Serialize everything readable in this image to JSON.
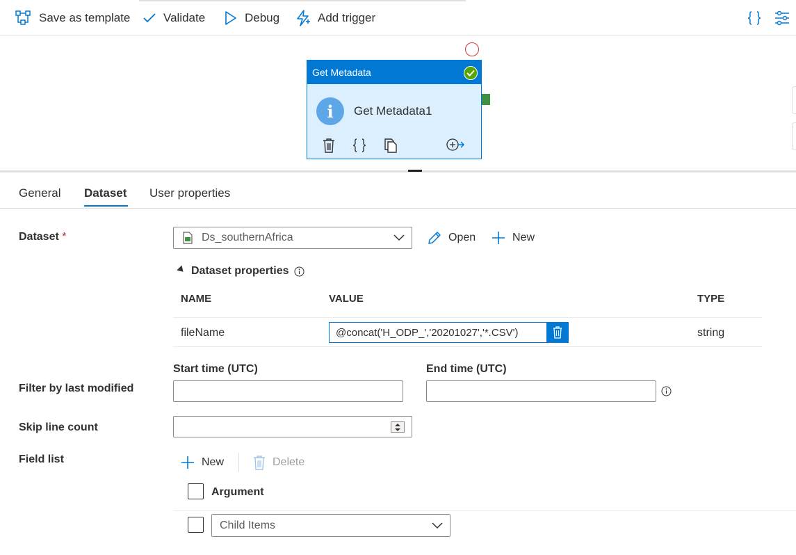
{
  "toolbar": {
    "save_template": "Save as template",
    "validate": "Validate",
    "debug": "Debug",
    "add_trigger": "Add trigger",
    "accent_color": "#0078d4"
  },
  "activity": {
    "header": "Get Metadata",
    "name": "Get Metadata1",
    "status": "succeeded"
  },
  "tabs": [
    {
      "label": "General"
    },
    {
      "label": "Dataset",
      "active": true
    },
    {
      "label": "User properties"
    }
  ],
  "dataset": {
    "label": "Dataset",
    "required_mark": "*",
    "selected": "Ds_southernAfrica",
    "open_label": "Open",
    "new_label": "New"
  },
  "dataset_properties": {
    "title": "Dataset properties",
    "columns": {
      "name": "NAME",
      "value": "VALUE",
      "type": "TYPE"
    },
    "rows": [
      {
        "name": "fileName",
        "value": "@concat('H_ODP_','20201027','*.CSV')",
        "type": "string"
      }
    ]
  },
  "filter": {
    "label": "Filter by last modified",
    "start_label": "Start time (UTC)",
    "end_label": "End time (UTC)",
    "start_value": "",
    "end_value": ""
  },
  "skip_line": {
    "label": "Skip line count",
    "value": ""
  },
  "field_list": {
    "label": "Field list",
    "new_label": "New",
    "delete_label": "Delete",
    "header": "Argument",
    "items": [
      {
        "value": "Child Items"
      }
    ]
  }
}
